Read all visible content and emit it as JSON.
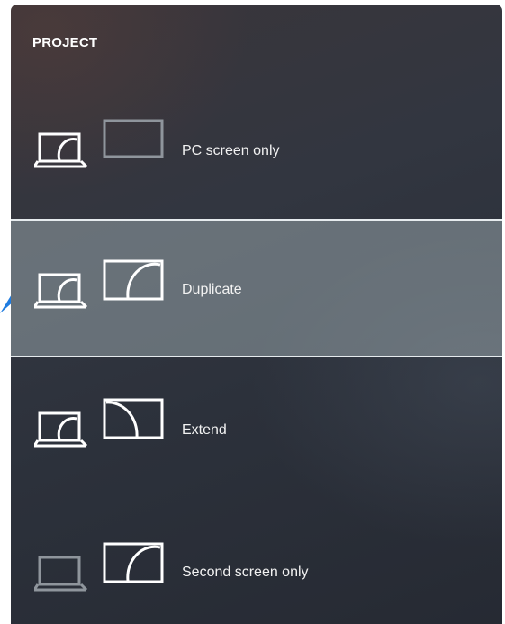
{
  "panel": {
    "title": "PROJECT"
  },
  "options": [
    {
      "label": "PC screen only",
      "selected": false,
      "icon": "pc-screen-only-icon"
    },
    {
      "label": "Duplicate",
      "selected": true,
      "icon": "duplicate-icon"
    },
    {
      "label": "Extend",
      "selected": false,
      "icon": "extend-icon"
    },
    {
      "label": "Second screen only",
      "selected": false,
      "icon": "second-screen-only-icon"
    }
  ],
  "colors": {
    "pointer_arrow": "#1f7ce0",
    "selection_border": "#e6ebee"
  }
}
